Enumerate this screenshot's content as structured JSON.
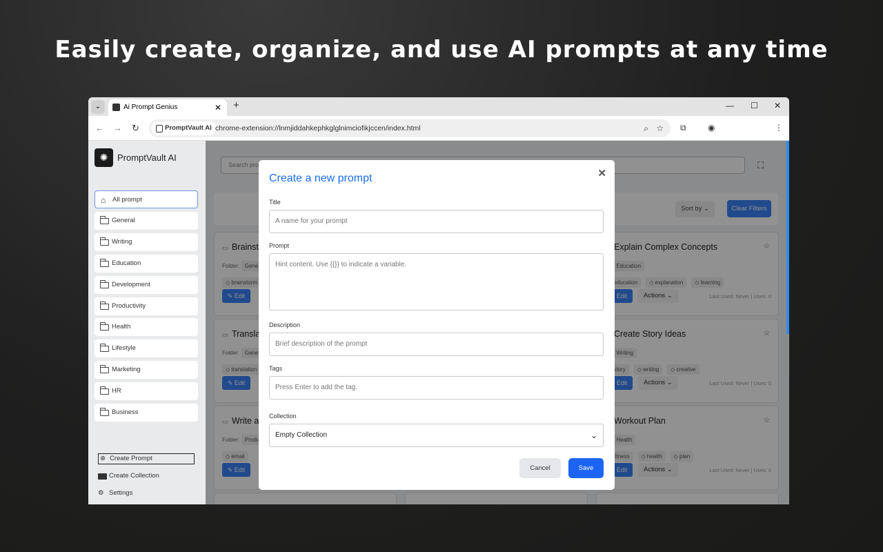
{
  "headline": "Easily create, organize, and use AI prompts at any time",
  "browser": {
    "tab_title": "Ai Prompt Genius",
    "site_chip": "PromptVault AI",
    "url": "chrome-extension://lnmjiddahkephkglglnimciofikjccen/index.html"
  },
  "sidebar": {
    "brand": "PromptVault AI",
    "items": [
      {
        "label": "All prompt"
      },
      {
        "label": "General"
      },
      {
        "label": "Writing"
      },
      {
        "label": "Education"
      },
      {
        "label": "Development"
      },
      {
        "label": "Productivity"
      },
      {
        "label": "Health"
      },
      {
        "label": "Lifestyle"
      },
      {
        "label": "Marketing"
      },
      {
        "label": "HR"
      },
      {
        "label": "Business"
      }
    ],
    "create_prompt": "Create Prompt",
    "create_collection": "Create Collection",
    "settings": "Settings"
  },
  "main": {
    "search_placeholder": "Search pro",
    "sort_by": "Sort by",
    "clear_filters": "Clear Filters",
    "cards": [
      {
        "title": "Brainsto",
        "folder_label": "Folder:",
        "folder": "Gener",
        "tags": [
          "brainstorm"
        ],
        "edit": "Edit"
      },
      {
        "title": "Translat",
        "folder_label": "Folder:",
        "folder": "Gener",
        "tags": [
          "translation"
        ],
        "edit": "Edit"
      },
      {
        "title": "Write a",
        "folder_label": "Folder:",
        "folder": "Produ",
        "tags": [
          "email"
        ],
        "edit": "Edit"
      },
      {
        "title": "Explain Complex Concepts",
        "folder_label": "er:",
        "folder": "Education",
        "tags": [
          "education",
          "explanation",
          "learning"
        ],
        "edit": "Edit",
        "actions": "Actions",
        "last_used": "Last Used: Never | Uses: 0"
      },
      {
        "title": "Create Story Ideas",
        "folder_label": "er:",
        "folder": "Writing",
        "tags": [
          "story",
          "writing",
          "creative"
        ],
        "edit": "Edit",
        "actions": "Actions",
        "last_used": "Last Used: Never | Uses: 0"
      },
      {
        "title": "Workout Plan",
        "folder_label": "er:",
        "folder": "Health",
        "tags": [
          "fitness",
          "health",
          "plan"
        ],
        "edit": "Edit",
        "actions": "Actions",
        "last_used": "Last Used: Never | Uses: 0"
      }
    ]
  },
  "modal": {
    "title": "Create a new prompt",
    "title_label": "Title",
    "title_placeholder": "A name for your prompt",
    "prompt_label": "Prompt",
    "prompt_placeholder": "Hint content. Use {{}} to indicate a variable.",
    "description_label": "Description",
    "description_placeholder": "Brief description of the prompt",
    "tags_label": "Tags",
    "tags_placeholder": "Press Enter to add the tag.",
    "collection_label": "Collection",
    "collection_value": "Empty Collection",
    "cancel": "Cancel",
    "save": "Save"
  },
  "colors": {
    "accent": "#1a6ef0",
    "save": "#1d64f2"
  }
}
